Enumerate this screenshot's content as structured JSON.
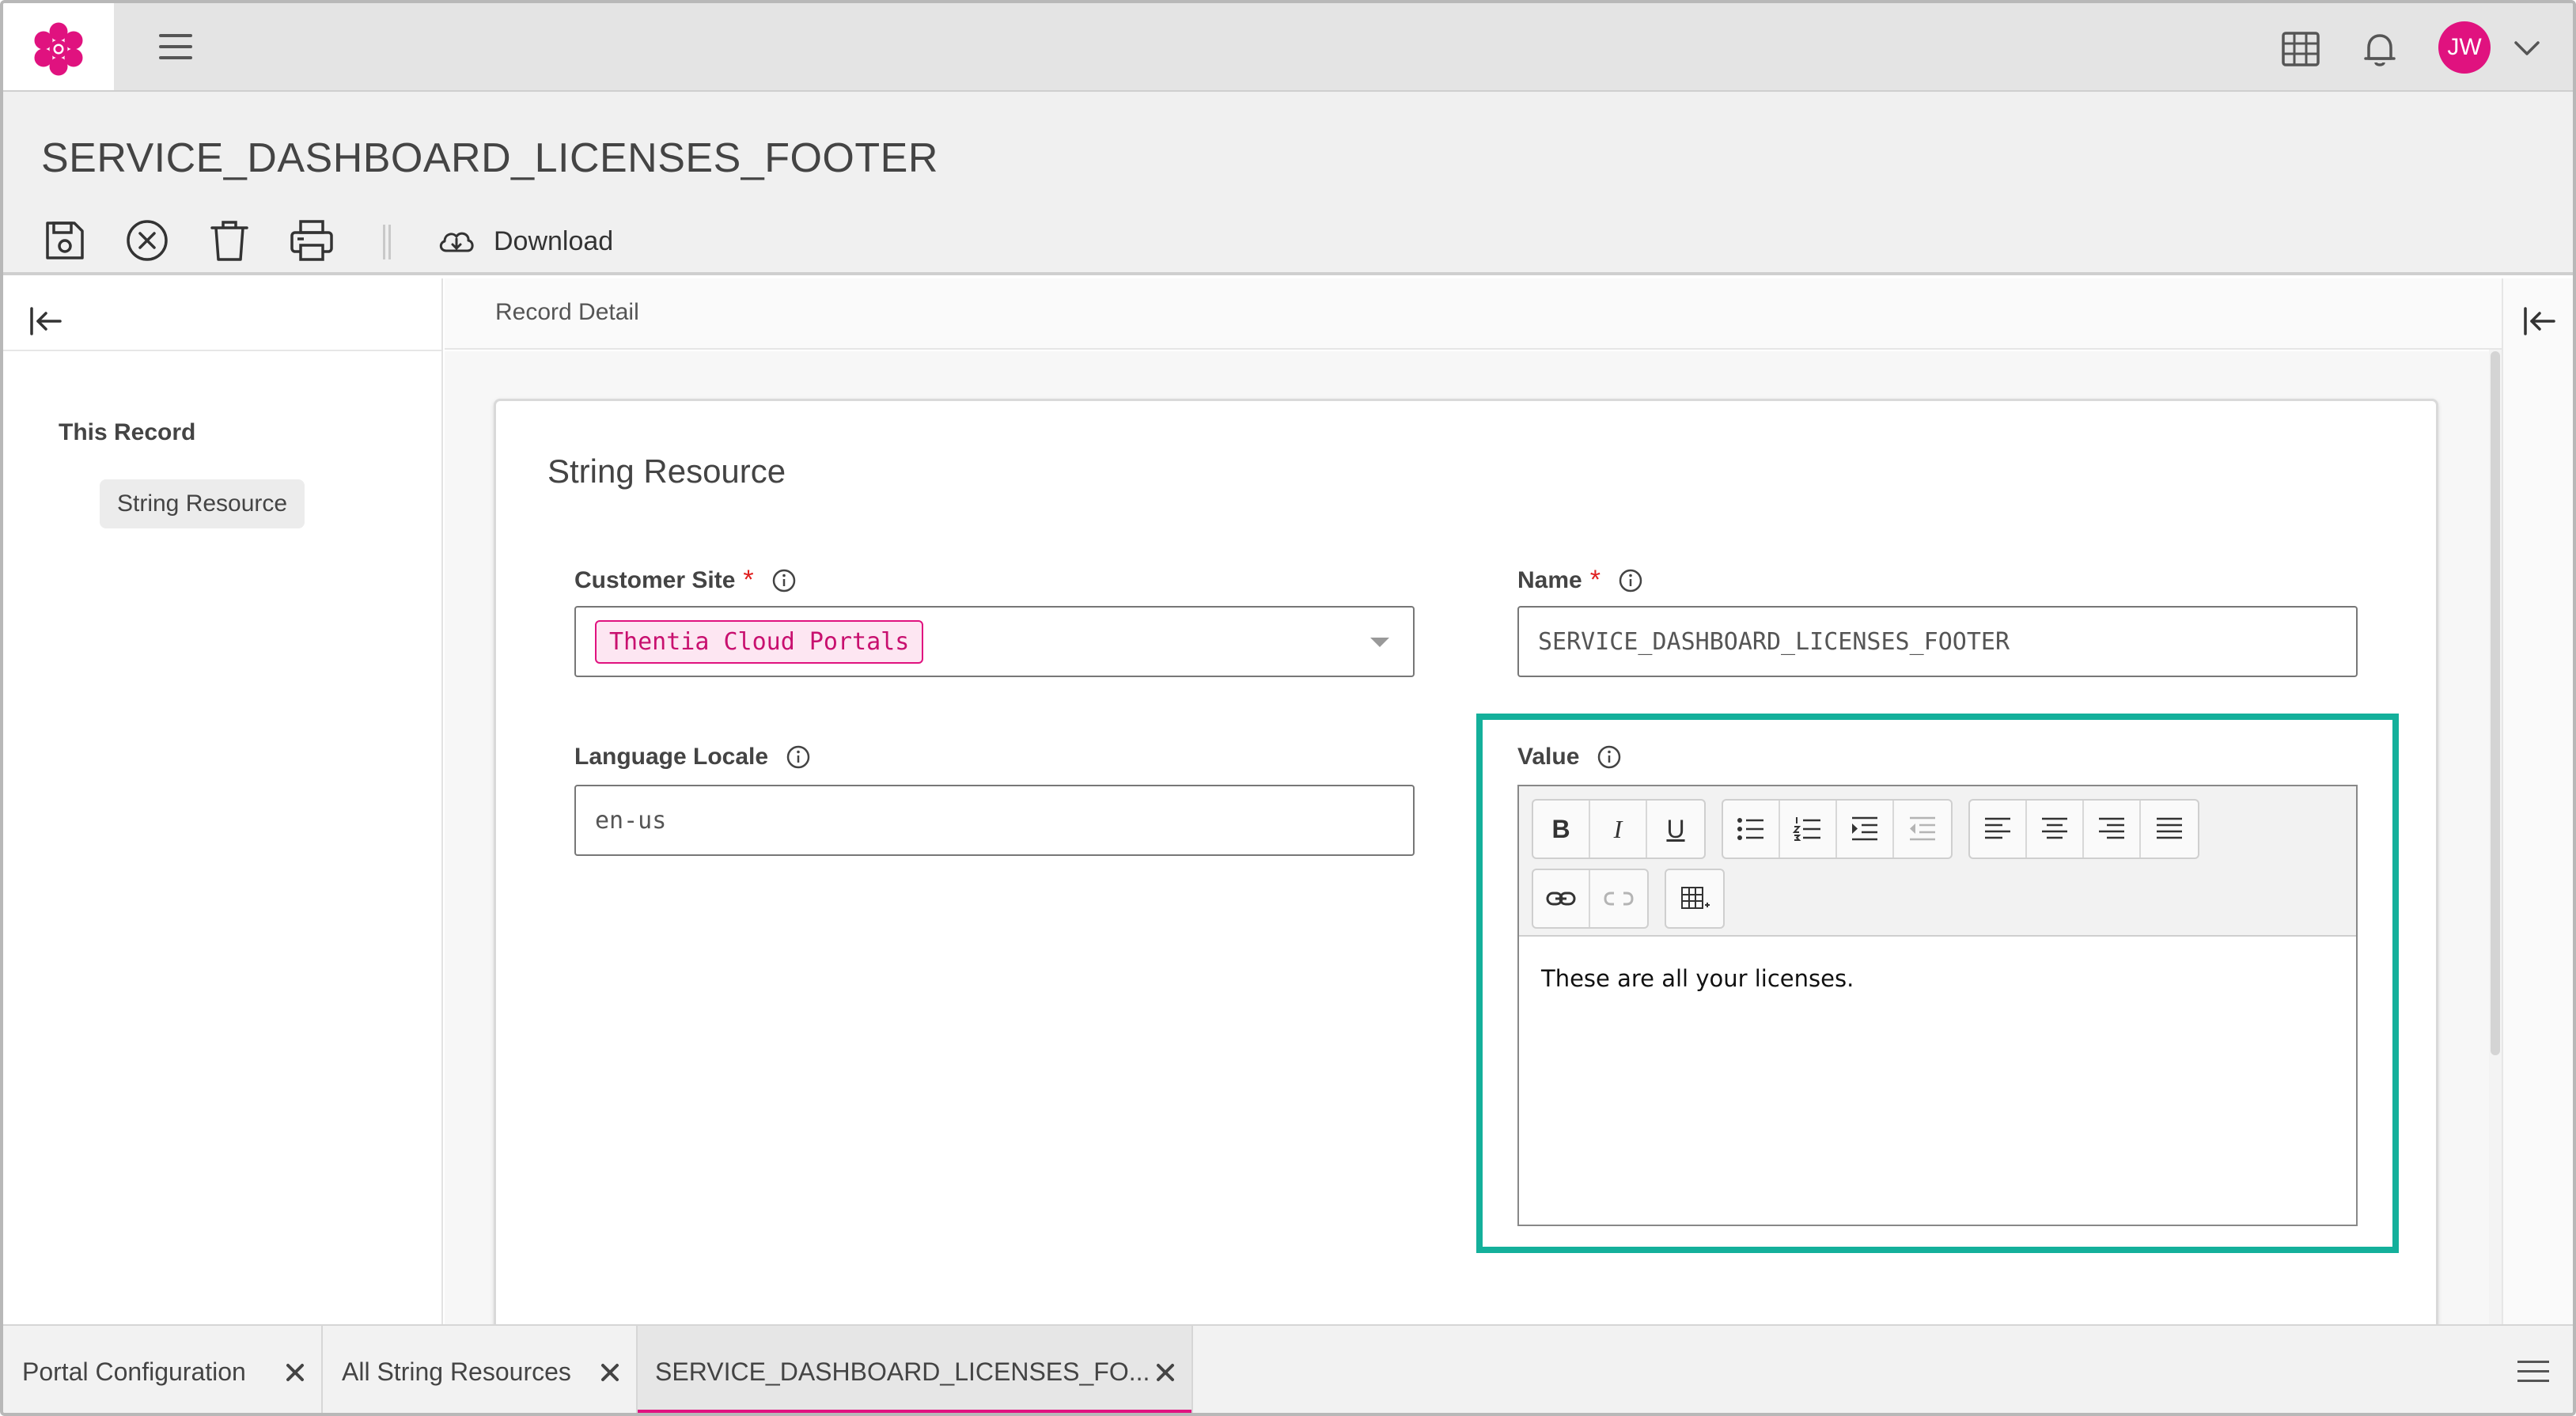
{
  "app": {
    "user_initials": "JW",
    "accent_color": "#e0127f",
    "highlight_color": "#14b09b"
  },
  "header": {
    "title": "SERVICE_DASHBOARD_LICENSES_FOOTER",
    "toolbar": {
      "icons": [
        "save-icon",
        "cancel-icon",
        "delete-icon",
        "print-icon",
        "cloud-download-icon"
      ],
      "download_label": "Download"
    }
  },
  "sidebar": {
    "section_title": "This Record",
    "items": [
      {
        "label": "String Resource"
      }
    ]
  },
  "detail": {
    "header_label": "Record Detail",
    "card_title": "String Resource",
    "fields": {
      "customer_site": {
        "label": "Customer Site",
        "required_mark": "*",
        "selected_value": "Thentia Cloud Portals"
      },
      "name": {
        "label": "Name",
        "required_mark": "*",
        "value": "SERVICE_DASHBOARD_LICENSES_FOOTER"
      },
      "language_locale": {
        "label": "Language Locale",
        "value": "en-us"
      },
      "value": {
        "label": "Value",
        "content": "These are all your licenses.",
        "toolbar": {
          "bold": "B",
          "italic": "I",
          "underline": "U"
        }
      }
    }
  },
  "tabs": [
    {
      "label": "Portal Configuration"
    },
    {
      "label": "All String Resources"
    },
    {
      "label": "SERVICE_DASHBOARD_LICENSES_FO..."
    }
  ]
}
